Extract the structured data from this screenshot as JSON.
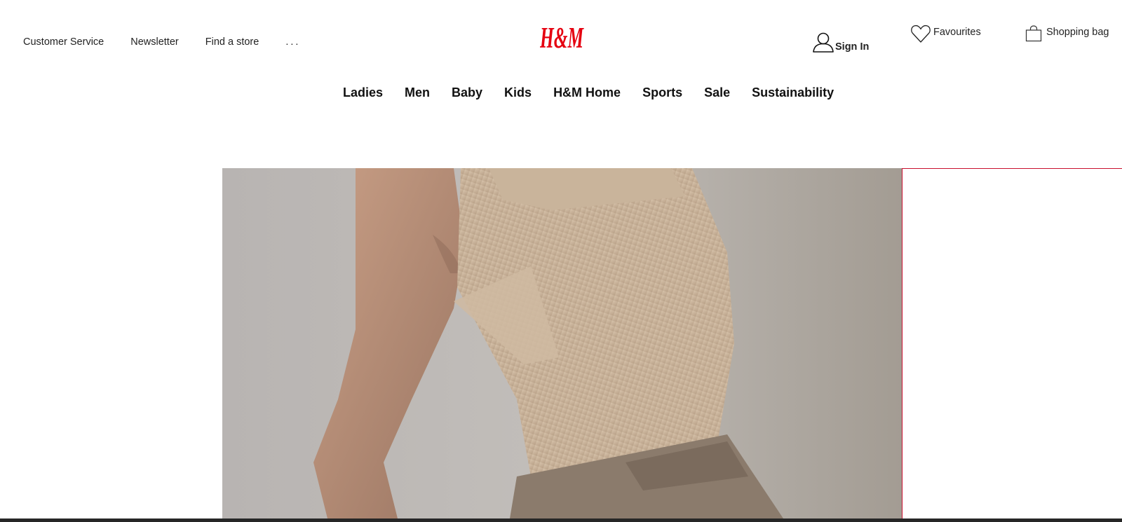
{
  "header": {
    "top_links": {
      "customer_service": "Customer Service",
      "newsletter": "Newsletter",
      "find_store": "Find a store",
      "more": "..."
    },
    "logo_text": "H&M",
    "account": {
      "sign_in": "Sign In",
      "icon": "user-icon"
    },
    "favourites": {
      "label": "Favourites",
      "icon": "heart-icon"
    },
    "bag": {
      "label": "Shopping bag",
      "icon": "shopping-bag-icon"
    }
  },
  "main_nav": {
    "ladies": "Ladies",
    "men": "Men",
    "baby": "Baby",
    "kids": "Kids",
    "home": "H&M Home",
    "sports": "Sports",
    "sale": "Sale",
    "sustainability": "Sustainability"
  },
  "colors": {
    "brand_red": "#e50010",
    "panel_border": "#c8102e",
    "text": "#222222",
    "bottom_bar": "#262626"
  }
}
